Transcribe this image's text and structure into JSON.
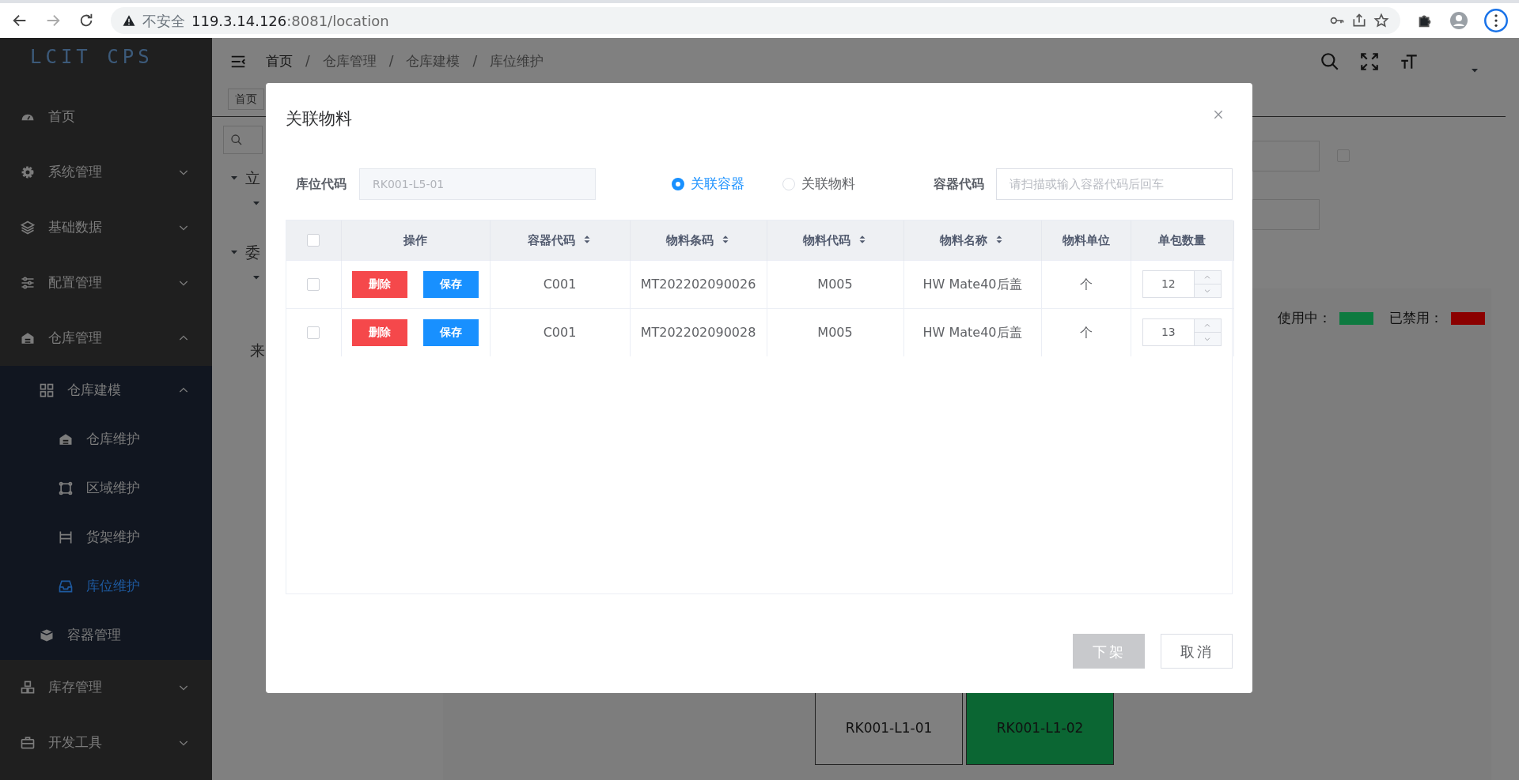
{
  "browser": {
    "security_label": "不安全",
    "url_host": "119.3.14.126",
    "url_rest": ":8081/location"
  },
  "sidebar": {
    "logo": "LCIT CPS",
    "items": [
      {
        "label": "首页",
        "selected": false
      },
      {
        "label": "系统管理",
        "selected": false,
        "expanded": false
      },
      {
        "label": "基础数据",
        "selected": false,
        "expanded": false
      },
      {
        "label": "配置管理",
        "selected": false,
        "expanded": false
      },
      {
        "label": "仓库管理",
        "selected": false,
        "expanded": true,
        "children": [
          {
            "label": "仓库建模",
            "selected": false,
            "expanded": true,
            "children": [
              {
                "label": "仓库维护",
                "selected": false
              },
              {
                "label": "区域维护",
                "selected": false
              },
              {
                "label": "货架维护",
                "selected": false
              },
              {
                "label": "库位维护",
                "selected": true
              }
            ]
          },
          {
            "label": "容器管理",
            "selected": false
          }
        ]
      },
      {
        "label": "库存管理",
        "selected": false,
        "expanded": false
      },
      {
        "label": "开发工具",
        "selected": false,
        "expanded": false
      }
    ]
  },
  "header": {
    "separator": "/",
    "breadcrumb": [
      "首页",
      "仓库管理",
      "仓库建模",
      "库位维护"
    ]
  },
  "tags": [
    {
      "label": "首页"
    }
  ],
  "tree_fragments": [
    "立",
    "委",
    "来"
  ],
  "filter_checkbox": {
    "checked": false
  },
  "legend": [
    {
      "label": "使用中：",
      "color": "#0e7a40"
    },
    {
      "label": "已禁用：",
      "color": "#8b0000"
    }
  ],
  "locations": [
    {
      "code": "RK001-L1-01",
      "color": "#808080"
    },
    {
      "code": "RK001-L1-02",
      "color": "#0b6633"
    }
  ],
  "dialog": {
    "title": "关联物料",
    "location_label": "库位代码",
    "location_value": "RK001-L5-01",
    "modes": [
      {
        "label": "关联容器",
        "selected": true
      },
      {
        "label": "关联物料",
        "selected": false
      }
    ],
    "container_label": "容器代码",
    "container_placeholder": "请扫描或输入容器代码后回车",
    "columns": [
      {
        "kind": "checkbox",
        "checked": false
      },
      {
        "kind": "text",
        "label": "操作",
        "sortable": false
      },
      {
        "kind": "text",
        "label": "容器代码",
        "sortable": true
      },
      {
        "kind": "text",
        "label": "物料条码",
        "sortable": true
      },
      {
        "kind": "text",
        "label": "物料代码",
        "sortable": true
      },
      {
        "kind": "text",
        "label": "物料名称",
        "sortable": true
      },
      {
        "kind": "text",
        "label": "物料单位",
        "sortable": false
      },
      {
        "kind": "text",
        "label": "单包数量",
        "sortable": false
      }
    ],
    "rows": [
      {
        "cells": [
          {
            "kind": "checkbox",
            "checked": false
          },
          {
            "kind": "actions",
            "buttons": [
              "删除",
              "保存"
            ]
          },
          {
            "kind": "text",
            "text": "C001"
          },
          {
            "kind": "text",
            "text": "MT202202090026"
          },
          {
            "kind": "text",
            "text": "M005"
          },
          {
            "kind": "text",
            "text": "HW Mate40后盖"
          },
          {
            "kind": "text",
            "text": "个"
          },
          {
            "kind": "stepper",
            "value": "12"
          }
        ]
      },
      {
        "cells": [
          {
            "kind": "checkbox",
            "checked": false
          },
          {
            "kind": "actions",
            "buttons": [
              "删除",
              "保存"
            ]
          },
          {
            "kind": "text",
            "text": "C001"
          },
          {
            "kind": "text",
            "text": "MT202202090028"
          },
          {
            "kind": "text",
            "text": "M005"
          },
          {
            "kind": "text",
            "text": "HW Mate40后盖"
          },
          {
            "kind": "text",
            "text": "个"
          },
          {
            "kind": "stepper",
            "value": "13"
          }
        ]
      }
    ],
    "buttons": [
      {
        "label": "下架",
        "kind": "primary",
        "disabled": true
      },
      {
        "label": "取消",
        "kind": "plain",
        "disabled": false
      }
    ]
  }
}
